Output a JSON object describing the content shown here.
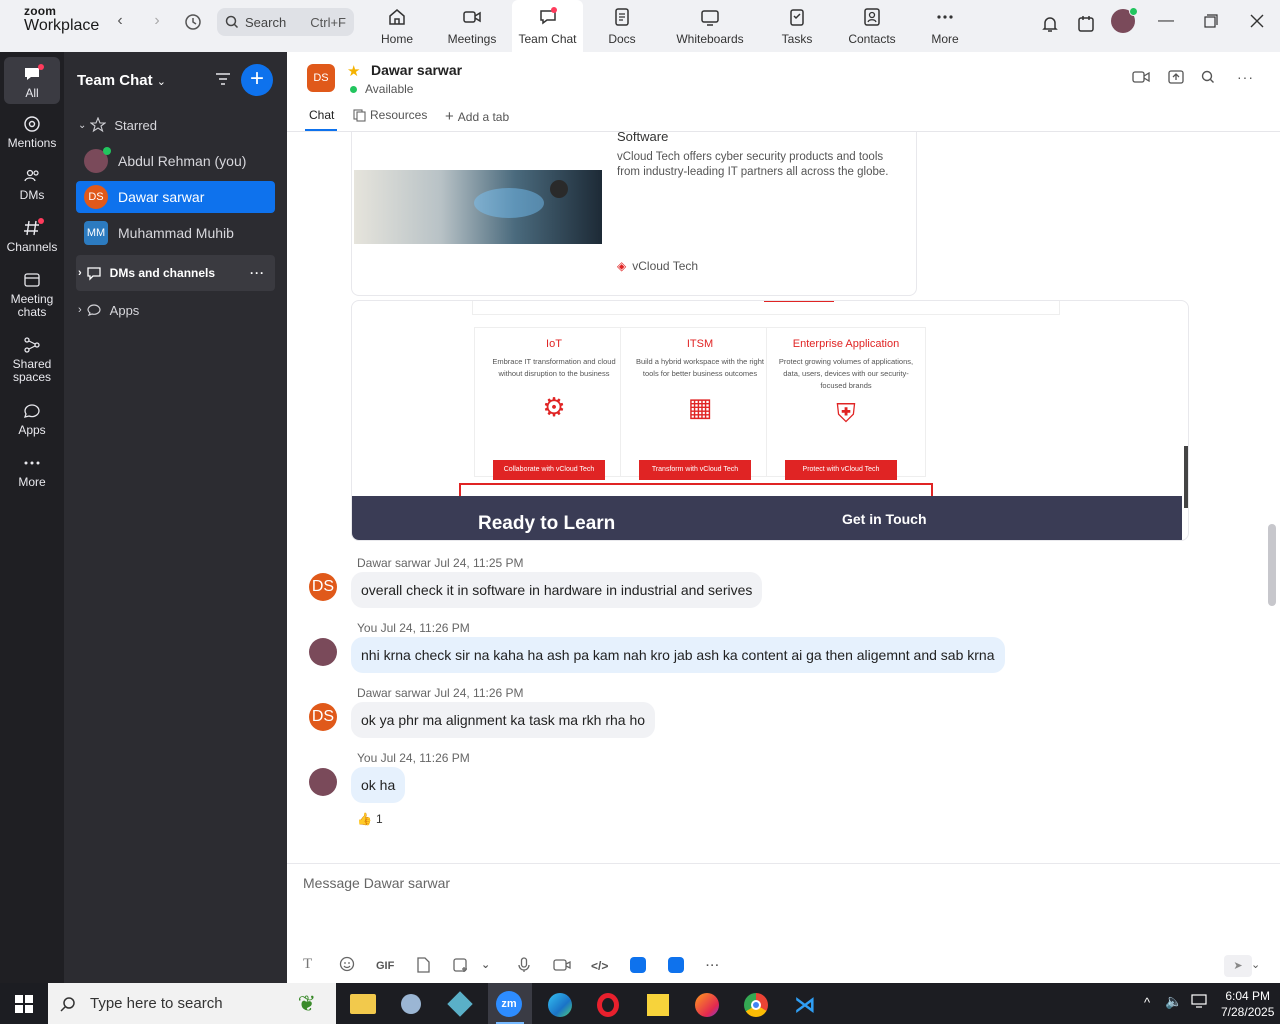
{
  "app": {
    "logo_top": "zoom",
    "logo_bottom": "Workplace"
  },
  "search": {
    "placeholder": "Search",
    "shortcut": "Ctrl+F"
  },
  "tabs": [
    {
      "label": "Home"
    },
    {
      "label": "Meetings"
    },
    {
      "label": "Team Chat"
    },
    {
      "label": "Docs"
    },
    {
      "label": "Whiteboards"
    },
    {
      "label": "Tasks"
    },
    {
      "label": "Contacts"
    },
    {
      "label": "More"
    }
  ],
  "rail": [
    {
      "label": "All"
    },
    {
      "label": "Mentions"
    },
    {
      "label": "DMs"
    },
    {
      "label": "Channels"
    },
    {
      "label": "Meeting chats"
    },
    {
      "label": "Shared spaces"
    },
    {
      "label": "Apps"
    },
    {
      "label": "More"
    }
  ],
  "sidebar": {
    "title": "Team Chat",
    "starred_label": "Starred",
    "contacts": [
      {
        "name": "Abdul Rehman (you)",
        "initials": ""
      },
      {
        "name": "Dawar sarwar",
        "initials": "DS"
      },
      {
        "name": "Muhammad Muhib",
        "initials": "MM"
      }
    ],
    "dms_label": "DMs and channels",
    "apps_label": "Apps"
  },
  "chat": {
    "initials": "DS",
    "name": "Dawar sarwar",
    "status": "Available",
    "tabs": [
      "Chat",
      "Resources",
      "Add a tab"
    ]
  },
  "preview": {
    "heading": "Software",
    "desc": "vCloud Tech offers cyber security products and tools from industry-leading IT partners all across the globe.",
    "brand": "vCloud Tech"
  },
  "screenshot": {
    "cards": [
      {
        "title": "IoT",
        "desc": "Embrace IT transformation and cloud without disruption to the business",
        "button": "Collaborate with vCloud Tech"
      },
      {
        "title": "ITSM",
        "desc": "Build a hybrid workspace with the right tools for better business outcomes",
        "button": "Transform with vCloud Tech"
      },
      {
        "title": "Enterprise Application",
        "desc": "Protect growing volumes of applications, data, users, devices with our security-focused brands",
        "button": "Protect with vCloud Tech"
      }
    ],
    "banner_left": "Ready to Learn",
    "banner_right": "Get in Touch"
  },
  "messages": [
    {
      "sender": "Dawar sarwar Jul 24, 11:25 PM",
      "text": "overall check it in software in hardware in industrial and serives",
      "initials": "DS"
    },
    {
      "sender": "You Jul 24, 11:26 PM",
      "text": "nhi krna check sir na kaha ha ash pa kam nah kro jab  ash ka content ai ga then aligemnt and sab krna"
    },
    {
      "sender": "Dawar sarwar Jul 24, 11:26 PM",
      "text": "ok ya phr ma alignment ka task ma rkh rha ho",
      "initials": "DS"
    },
    {
      "sender": "You Jul 24, 11:26 PM",
      "text": "ok ha"
    }
  ],
  "reaction": {
    "emoji": "👍",
    "count": "1"
  },
  "composer": {
    "placeholder": "Message Dawar sarwar",
    "gif": "GIF"
  },
  "taskbar": {
    "search_placeholder": "Type here to search",
    "time": "6:04 PM",
    "date": "7/28/2025"
  }
}
